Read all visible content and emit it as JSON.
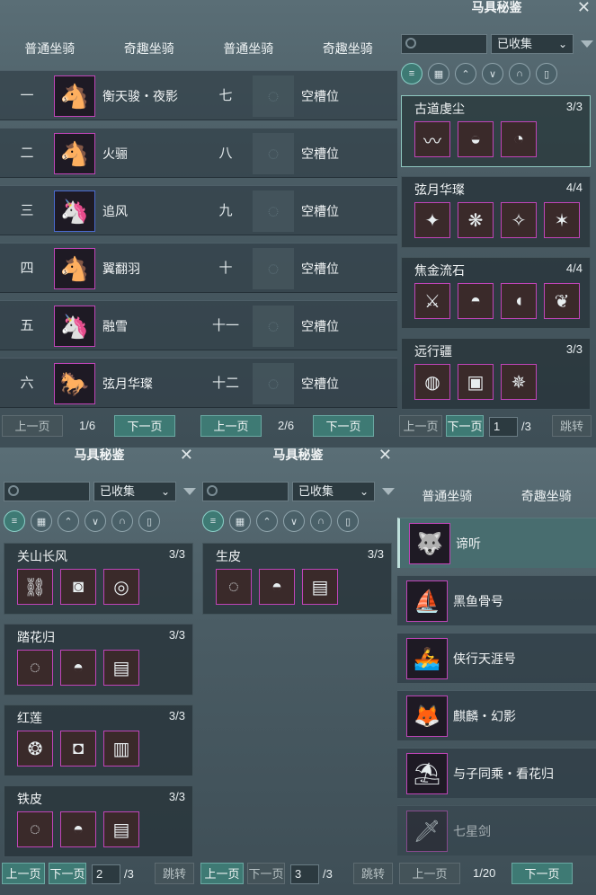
{
  "mount_tabs": {
    "normal": "普通坐骑",
    "fun": "奇趣坐骑"
  },
  "panel1": {
    "rows": [
      {
        "num": "一",
        "name": "衡天骏・夜影",
        "icon": "horse-dark"
      },
      {
        "num": "二",
        "name": "火骊",
        "icon": "horse-fire"
      },
      {
        "num": "三",
        "name": "追风",
        "icon": "horse-white-blue"
      },
      {
        "num": "四",
        "name": "翼翻羽",
        "icon": "horse-black"
      },
      {
        "num": "五",
        "name": "融雪",
        "icon": "horse-white-red"
      },
      {
        "num": "六",
        "name": "弦月华璨",
        "icon": "horse-white"
      }
    ],
    "pager": {
      "prev": "上一页",
      "page": "1/6",
      "next": "下一页"
    }
  },
  "panel2": {
    "rows": [
      {
        "num": "七",
        "name": "空槽位"
      },
      {
        "num": "八",
        "name": "空槽位"
      },
      {
        "num": "九",
        "name": "空槽位"
      },
      {
        "num": "十",
        "name": "空槽位"
      },
      {
        "num": "十一",
        "name": "空槽位"
      },
      {
        "num": "十二",
        "name": "空槽位"
      }
    ],
    "pager": {
      "prev": "上一页",
      "page": "2/6",
      "next": "下一页"
    }
  },
  "codex_title": "马具秘鉴",
  "filter_select": "已收集",
  "panel3": {
    "sets": [
      {
        "name": "古道虔尘",
        "count": "3/3",
        "items": 3
      },
      {
        "name": "弦月华璨",
        "count": "4/4",
        "items": 4
      },
      {
        "name": "焦金流石",
        "count": "4/4",
        "items": 4
      },
      {
        "name": "远行疆",
        "count": "3/3",
        "items": 3
      }
    ],
    "pager": {
      "prev": "上一页",
      "next": "下一页",
      "input": "1",
      "total": "/3",
      "jump": "跳转"
    }
  },
  "panel4": {
    "sets": [
      {
        "name": "关山长风",
        "count": "3/3",
        "items": 3
      },
      {
        "name": "踏花归",
        "count": "3/3",
        "items": 3
      },
      {
        "name": "红莲",
        "count": "3/3",
        "items": 3
      },
      {
        "name": "铁皮",
        "count": "3/3",
        "items": 3
      }
    ],
    "pager": {
      "prev": "上一页",
      "next": "下一页",
      "input": "2",
      "total": "/3",
      "jump": "跳转"
    }
  },
  "panel5": {
    "sets": [
      {
        "name": "生皮",
        "count": "3/3",
        "items": 3
      }
    ],
    "pager": {
      "prev": "上一页",
      "next": "下一页",
      "input": "3",
      "total": "/3",
      "jump": "跳转"
    }
  },
  "panel6": {
    "rows": [
      {
        "name": "谛听"
      },
      {
        "name": "黑鱼骨号"
      },
      {
        "name": "侠行天涯号"
      },
      {
        "name": "麒麟・幻影"
      },
      {
        "name": "与子同乘・看花归"
      },
      {
        "name": "七星剑"
      }
    ],
    "pager": {
      "prev": "上一页",
      "page": "1/20",
      "next": "下一页"
    }
  }
}
